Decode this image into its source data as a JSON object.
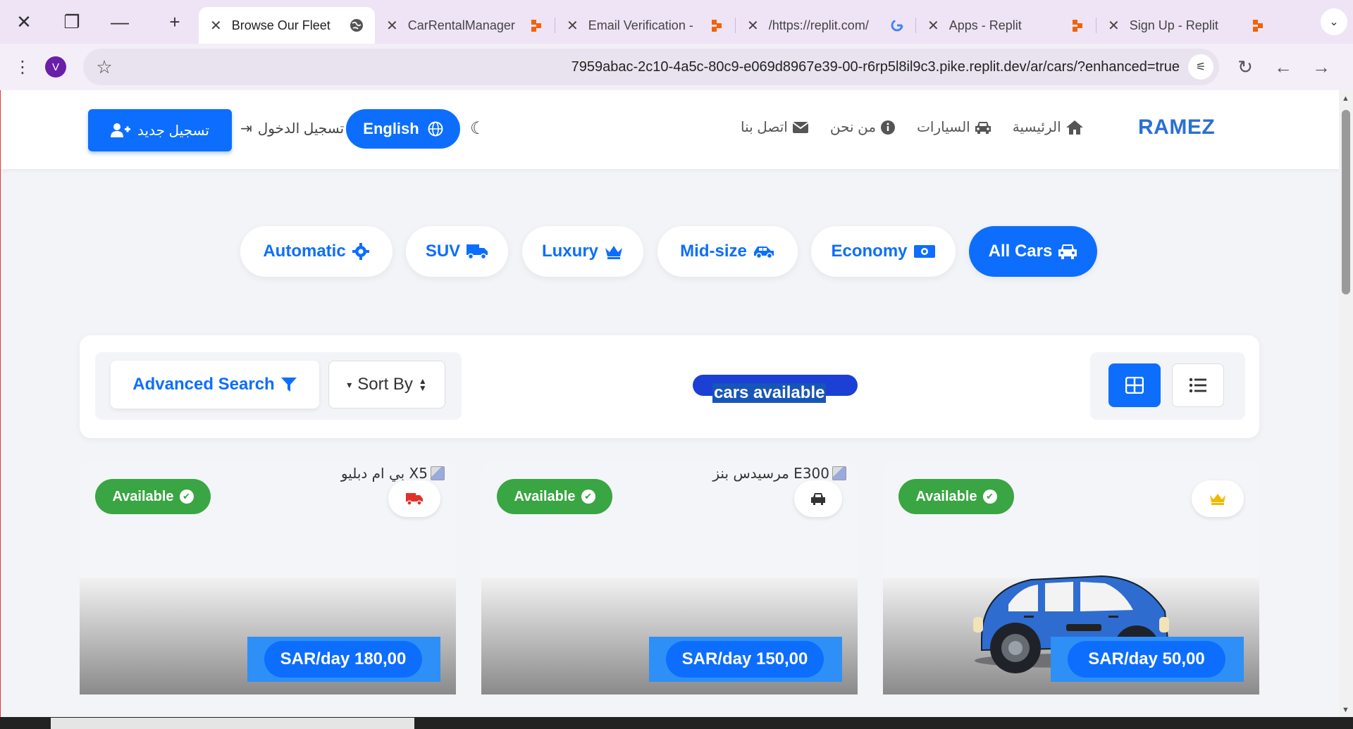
{
  "browser": {
    "tabs": [
      {
        "title": "Browse Our Fleet",
        "active": true,
        "favicon": "globe-icon"
      },
      {
        "title": "CarRentalManager",
        "active": false,
        "favicon": "replit-icon"
      },
      {
        "title": "Email Verification -",
        "active": false,
        "favicon": "replit-icon"
      },
      {
        "title": "/https://replit.com/",
        "active": false,
        "favicon": "google-icon"
      },
      {
        "title": "Apps - Replit",
        "active": false,
        "favicon": "replit-icon"
      },
      {
        "title": "Sign Up - Replit",
        "active": false,
        "favicon": "replit-icon"
      }
    ],
    "profile_initial": "V",
    "url": "7959abac-2c10-4a5c-80c9-e069d8967e39-00-r6rp5l8il9c3.pike.replit.dev/ar/cars/?enhanced=true"
  },
  "header": {
    "brand": "RAMEZ",
    "nav": {
      "home": "الرئيسية",
      "cars": "السيارات",
      "about": "من نحن",
      "contact": "اتصل بنا"
    },
    "language_button": "English",
    "login": "تسجيل الدخول",
    "register": "تسجيل جديد"
  },
  "categories": [
    {
      "label": "Automatic",
      "icon": "gear-icon",
      "active": false
    },
    {
      "label": "SUV",
      "icon": "truck-icon",
      "active": false
    },
    {
      "label": "Luxury",
      "icon": "crown-icon",
      "active": false
    },
    {
      "label": "Mid-size",
      "icon": "car-side-icon",
      "active": false
    },
    {
      "label": "Economy",
      "icon": "money-icon",
      "active": false
    },
    {
      "label": "All Cars",
      "icon": "car-icon",
      "active": true
    }
  ],
  "search": {
    "advanced": "Advanced Search",
    "sort": "Sort By",
    "count_text": "cars available"
  },
  "cars": [
    {
      "alt": "بي ام دبليو X5",
      "status": "Available",
      "price": "SAR/day 180,00",
      "type_icon": "truck-icon"
    },
    {
      "alt": "مرسيدس بنز E300",
      "status": "Available",
      "price": "SAR/day 150,00",
      "type_icon": "car-icon"
    },
    {
      "alt": "",
      "status": "Available",
      "price": "SAR/day 50,00",
      "type_icon": "crown-icon"
    }
  ],
  "colors": {
    "primary": "#0d6efd",
    "success": "#3aa543",
    "brand": "#2a6fd6"
  }
}
